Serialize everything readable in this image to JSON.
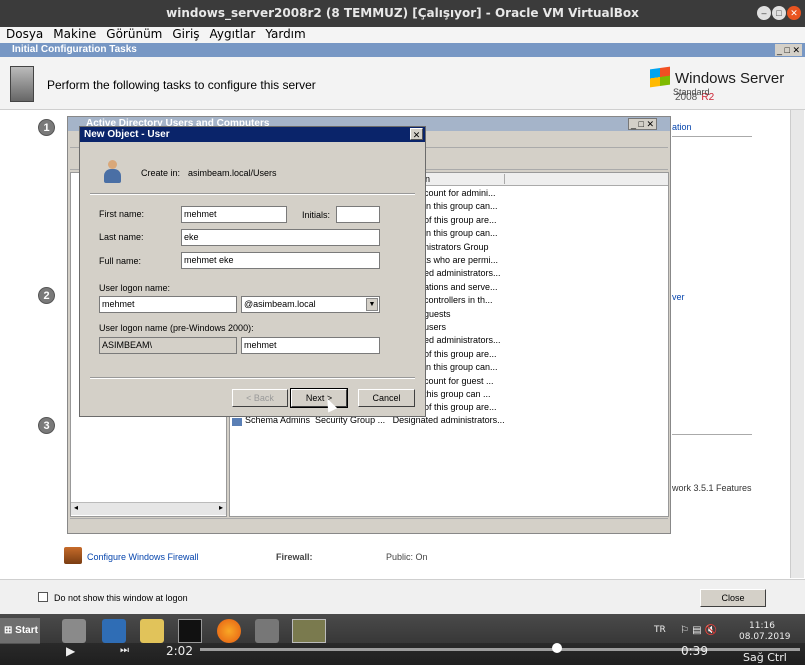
{
  "vbox": {
    "title": "windows_server2008r2 (8 TEMMUZ) [Çalışıyor] - Oracle VM VirtualBox",
    "menu": [
      "Dosya",
      "Makine",
      "Görünüm",
      "Giriş",
      "Aygıtlar",
      "Yardım"
    ],
    "host_key": "Sağ Ctrl"
  },
  "ict": {
    "title": "Initial Configuration Tasks",
    "heading": "Perform the following tasks to configure this server",
    "logo_brand": "Windows Server",
    "logo_year": "2008",
    "logo_r2": "R2",
    "logo_edition": "Standard",
    "steps": [
      "1",
      "2",
      "3"
    ],
    "right_links": [
      "ation",
      "ver"
    ],
    "feature_text": "work 3.5.1 Features",
    "firewall_link": "Configure Windows Firewall",
    "firewall_label": "Firewall:",
    "firewall_value": "Public: On",
    "dont_show": "Do not show this window at logon",
    "close": "Close"
  },
  "ad": {
    "title": "Active Directory Users and Computers",
    "list_header": "n",
    "rows": [
      "count for admini...",
      "in this group can...",
      "of this group are...",
      "in this group can...",
      "nistrators Group",
      "ts who are permi...",
      "ed administrators...",
      "ations and serve...",
      "controllers in th...",
      "guests",
      "users",
      "ed administrators...",
      "of this group are...",
      "in this group can...",
      "count for guest ...",
      "this group can ...",
      "of this group are..."
    ],
    "schema_row": {
      "name": "Schema Admins",
      "type": "Security Group ...",
      "desc": "Designated administrators..."
    }
  },
  "dialog": {
    "title": "New Object - User",
    "create_in_label": "Create in:",
    "create_in_value": "asimbeam.local/Users",
    "first_name_label": "First name:",
    "first_name": "mehmet",
    "initials_label": "Initials:",
    "initials": "",
    "last_name_label": "Last name:",
    "last_name": "eke",
    "full_name_label": "Full name:",
    "full_name": "mehmet eke",
    "logon_label": "User logon name:",
    "logon_name": "mehmet",
    "domain": "@asimbeam.local",
    "pre2000_label": "User logon name (pre-Windows 2000):",
    "pre2000_domain": "ASIMBEAM\\",
    "pre2000_name": "mehmet",
    "back": "< Back",
    "next": "Next >",
    "cancel": "Cancel"
  },
  "taskbar": {
    "start": "Start",
    "lang": "TR",
    "time": "11:16",
    "date": "08.07.2019"
  },
  "video": {
    "elapsed": "2:02",
    "hover_time": "0:39"
  }
}
